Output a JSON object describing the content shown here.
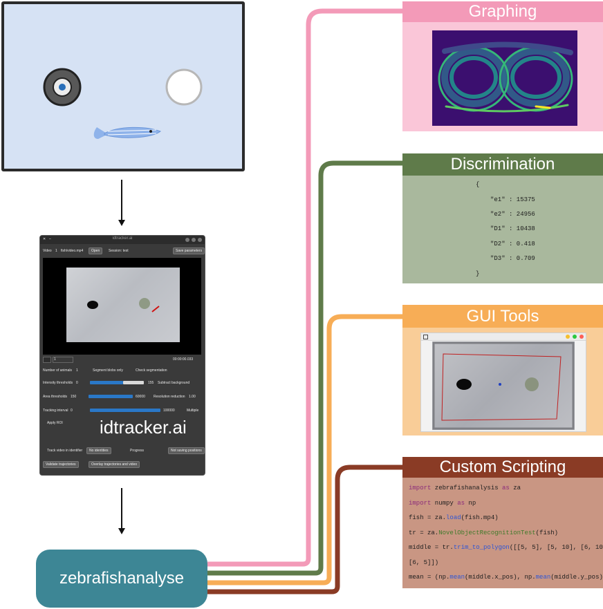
{
  "idtracker": {
    "window_title": "idtracker.ai",
    "video_label": "Video",
    "video_count": "1",
    "video_file": "fish/video.mp4",
    "open_button": "Open",
    "session_label": "Session: test",
    "advanced_button": "Save parameters",
    "frame_field": "1",
    "timecode": "00:00:00.033",
    "n_animals_label": "Number of animals",
    "n_animals_value": "1",
    "segment_label": "Segment blobs only",
    "check_label": "Check segmentation",
    "intensity_label": "Intensity thresholds",
    "intensity_low": "0",
    "intensity_high": "155",
    "subtract_bg_label": "Subtract background",
    "area_label": "Area thresholds",
    "area_low": "150",
    "area_high": "60000",
    "resolution_label": "Resolution reduction",
    "resolution_value": "1.00",
    "tracking_label": "Tracking interval",
    "tracking_start": "0",
    "tracking_end": "100000",
    "multiple_label": "Multiple",
    "roi_label": "Apply ROI",
    "brand": "idtracker.ai",
    "track_label": "Track video in identifier",
    "no_identities_label": "No identities",
    "progress_label": "Progress",
    "save_button": "Not saving positions",
    "validate_button": "Validate trajectories",
    "mix_button": "Overlay trajectories and video"
  },
  "zebrafish_box": {
    "label": "zebrafishanalyse"
  },
  "panels": {
    "graphing": {
      "title": "Graphing"
    },
    "discrimination": {
      "title": "Discrimination",
      "lines": [
        "{",
        "\"e1\" : 15375",
        "\"e2\" : 24956",
        "\"D1\" : 10438",
        "\"D2\" : 0.418",
        "\"D3\" : 0.709",
        "}"
      ]
    },
    "gui_tools": {
      "title": "GUI Tools"
    },
    "custom_scripting": {
      "title": "Custom Scripting",
      "code": [
        "import zebrafishanalysis as za",
        "import numpy as np",
        "fish = za.load(fish.mp4)",
        "tr = za.NovelObjectRecognitionTest(fish)",
        "middle = tr.trim_to_polygon([[5, 5], [5, 10], [6, 10],",
        "[6, 5]])",
        "mean = (np.mean(middle.x_pos), np.mean(middle.y_pos))"
      ]
    }
  },
  "colors": {
    "graphing": "#f39ab8",
    "discrimination": "#5f7b4a",
    "gui_tools": "#f7ad56",
    "custom_scripting": "#8a3b25",
    "zebrafishanalyse": "#3d8695"
  }
}
